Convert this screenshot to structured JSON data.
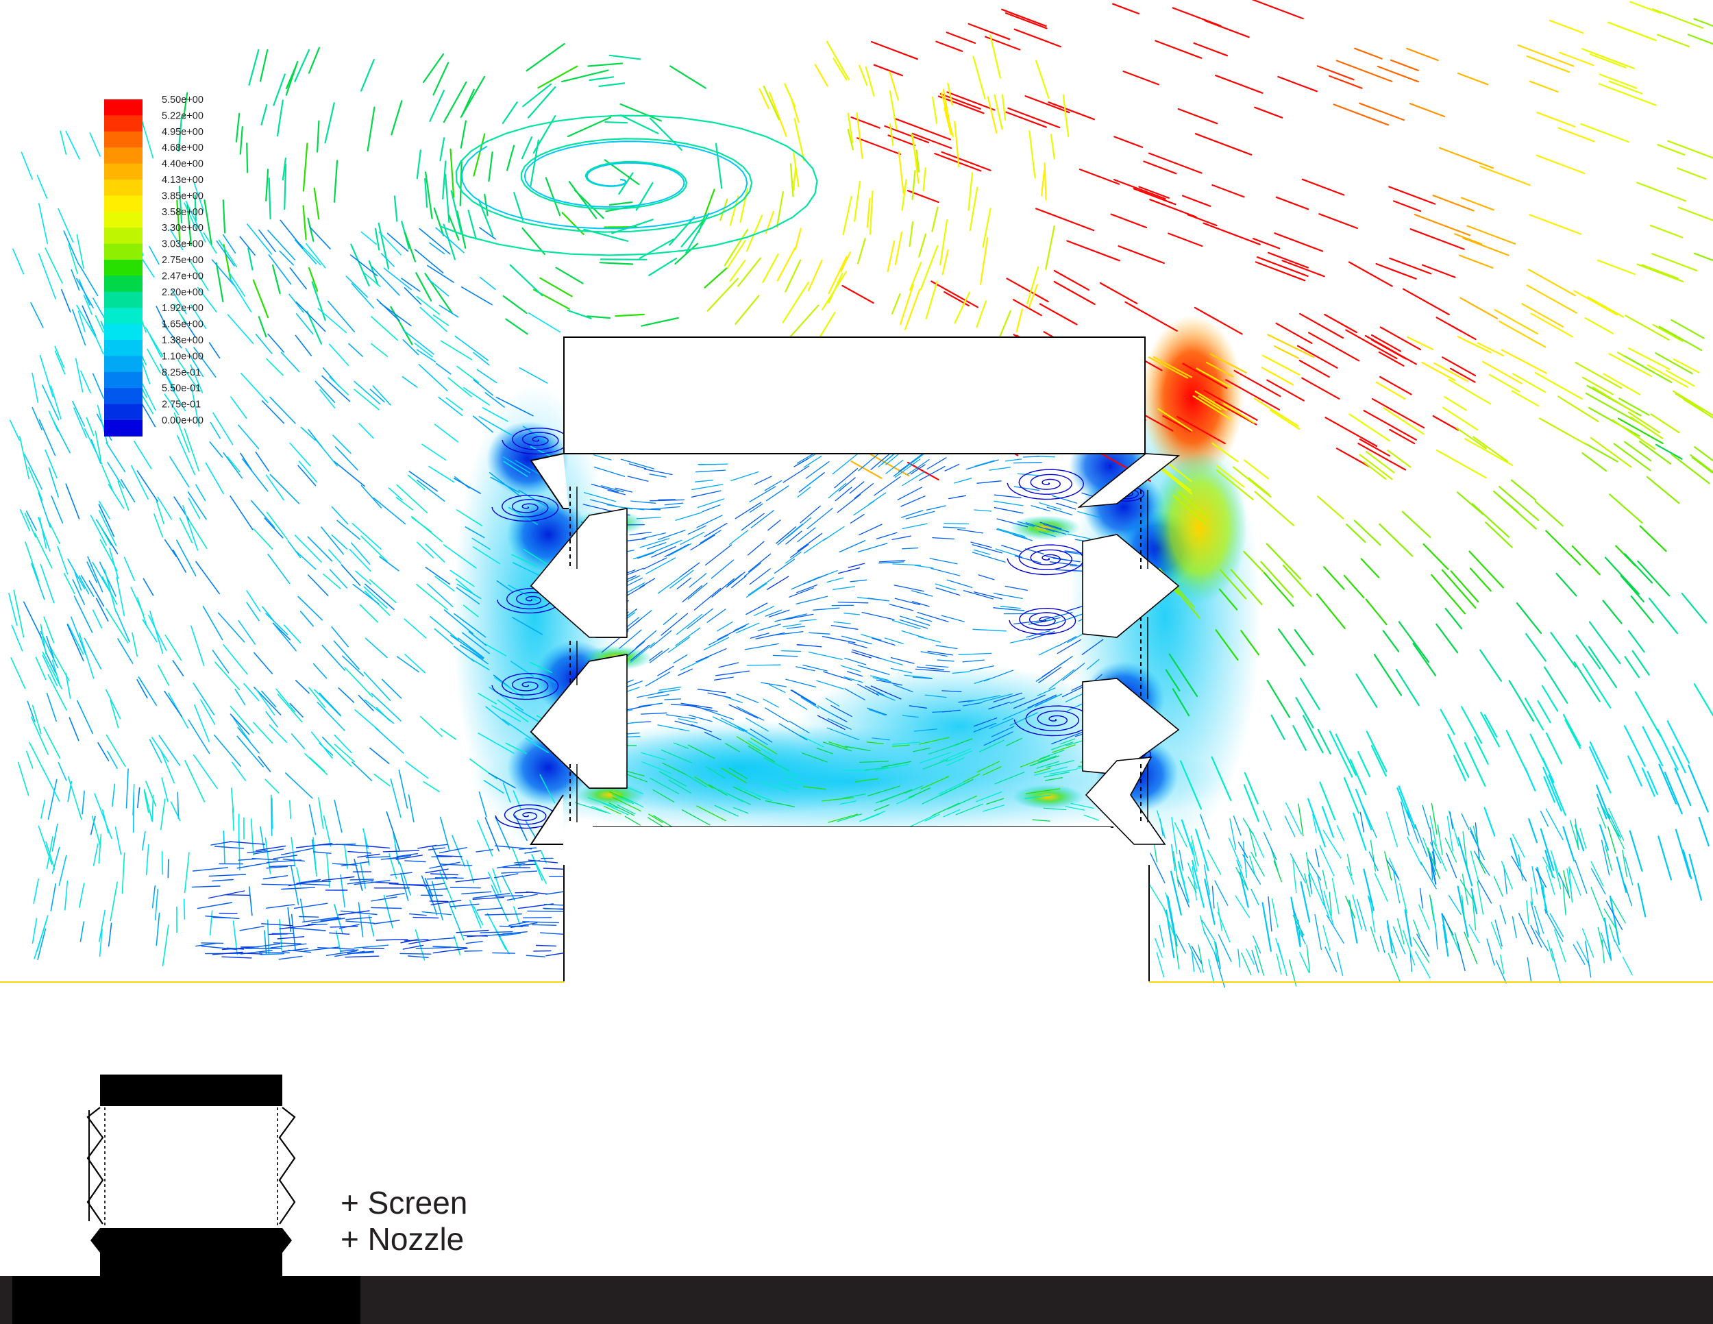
{
  "colorbar": {
    "labels": [
      "5.50e+00",
      "5.22e+00",
      "4.95e+00",
      "4.68e+00",
      "4.40e+00",
      "4.13e+00",
      "3.85e+00",
      "3.58e+00",
      "3.30e+00",
      "3.03e+00",
      "2.75e+00",
      "2.47e+00",
      "2.20e+00",
      "1.92e+00",
      "1.65e+00",
      "1.38e+00",
      "1.10e+00",
      "8.25e-01",
      "5.50e-01",
      "2.75e-01",
      "0.00e+00"
    ],
    "colors": [
      "#ff0000",
      "#ff3300",
      "#ff6a00",
      "#ff9400",
      "#ffb400",
      "#ffd400",
      "#ffee00",
      "#e8fb00",
      "#c0f500",
      "#8ef000",
      "#28e000",
      "#00d84a",
      "#00e09a",
      "#00eccc",
      "#00e4f2",
      "#00c8f6",
      "#00a8f6",
      "#0080f2",
      "#0058ee",
      "#0030e6",
      "#0000e0"
    ]
  },
  "colors": {
    "high": "#ff0000",
    "mid_high": "#ffd400",
    "mid": "#00e4a0",
    "low": "#00c8f6",
    "min": "#0000d0",
    "footer": "#231f20"
  },
  "captions": {
    "screen": "+ Screen",
    "nozzle": "+ Nozzle"
  }
}
